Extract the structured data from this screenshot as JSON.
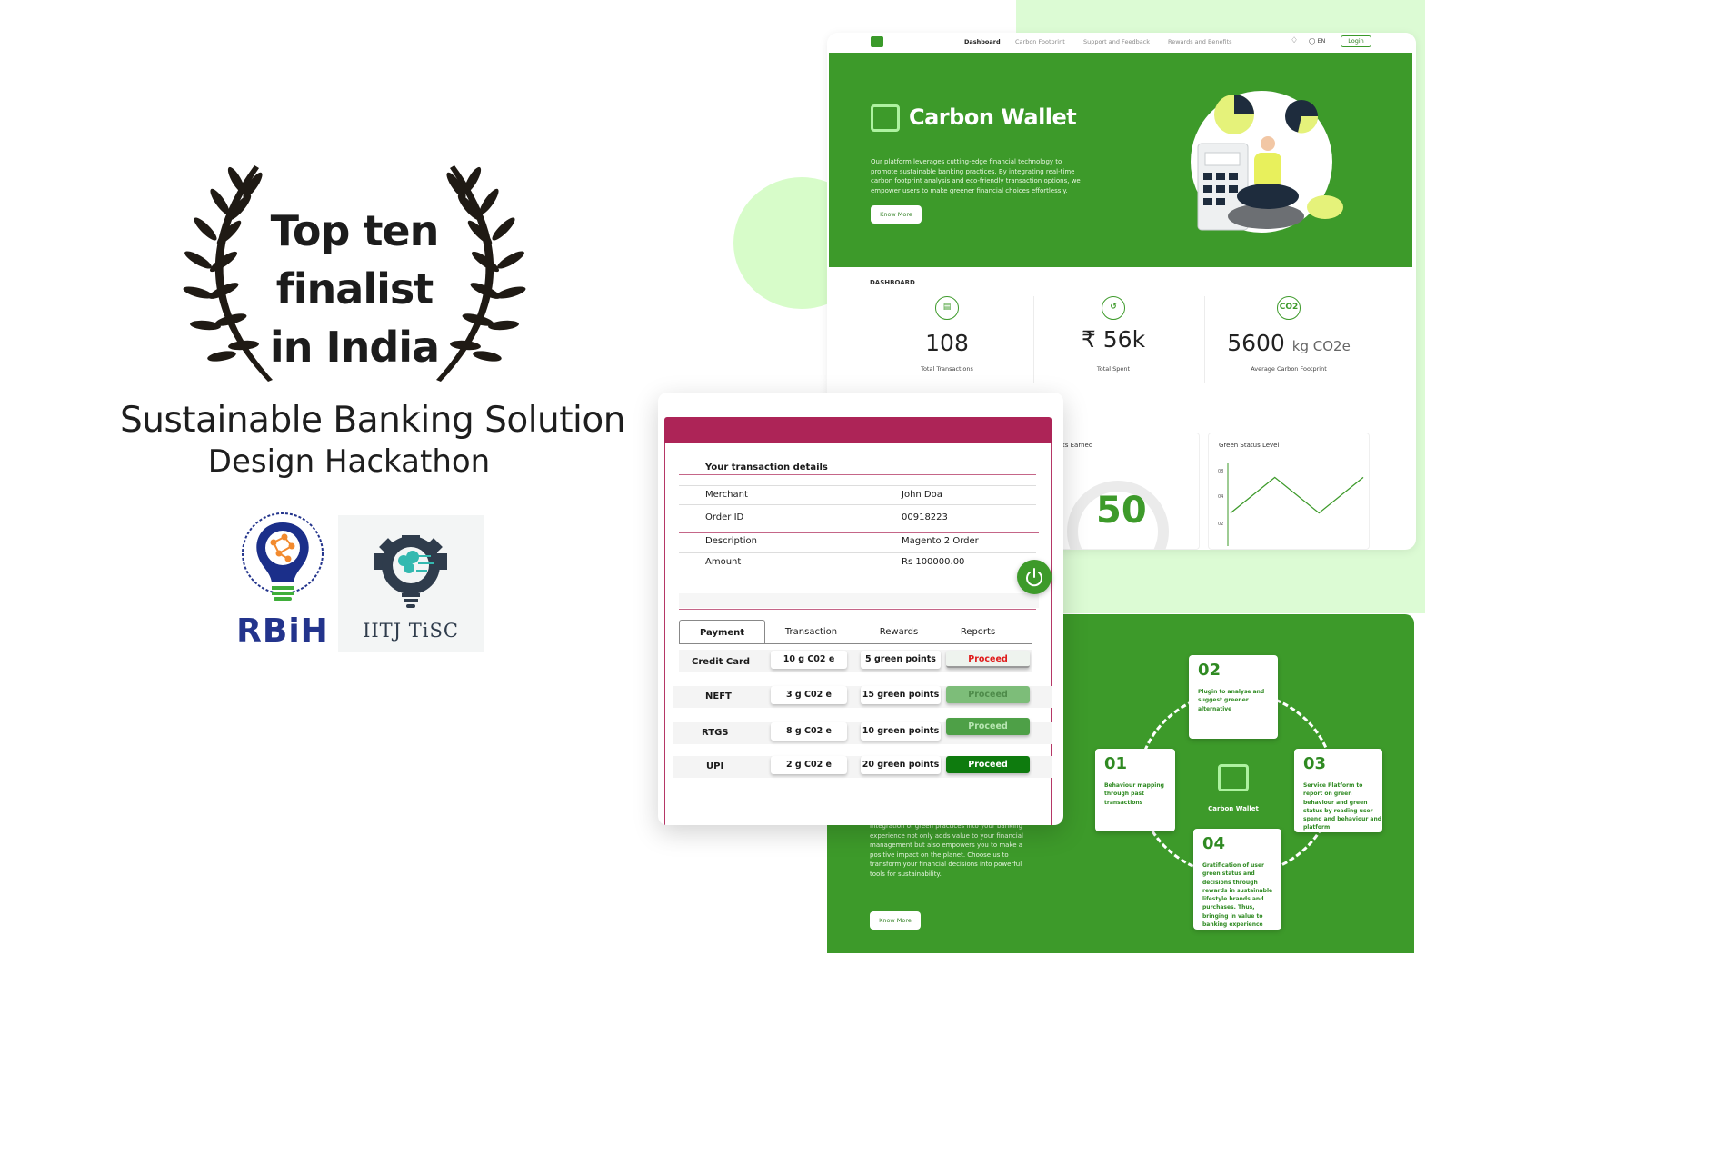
{
  "award": {
    "lines": [
      "Top ten",
      "finalist",
      "in India"
    ],
    "hackathon_title": "Sustainable Banking Solution",
    "hackathon_subtitle": "Design Hackathon"
  },
  "logos": {
    "rbih": "RBiH",
    "iitj": "IITJ TiSC"
  },
  "dashboard": {
    "nav": {
      "items": [
        "Dashboard",
        "Carbon Footprint",
        "Support and Feedback",
        "Rewards and Benefits"
      ],
      "lang": "EN",
      "login": "Login"
    },
    "hero": {
      "title": "Carbon Wallet",
      "description": "Our platform leverages cutting-edge financial technology to promote sustainable banking practices. By integrating real-time carbon footprint analysis and eco-friendly transaction options, we empower users to make greener financial choices effortlessly.",
      "button": "Know More"
    },
    "section_label": "DASHBOARD",
    "stats": [
      {
        "icon": "wallet-icon",
        "value": "108",
        "unit": "",
        "label": "Total Transactions"
      },
      {
        "icon": "rupee-exchange-icon",
        "value": "₹ 56k",
        "unit": "",
        "label": "Total Spent"
      },
      {
        "icon": "co2-icon",
        "icon_text": "CO2",
        "value": "5600",
        "unit": "kg CO2e",
        "label": "Average Carbon Footprint"
      }
    ],
    "panels": {
      "points_title": "ts Earned",
      "points_value": "50",
      "green_title": "Green Status Level",
      "green_ticks": [
        "08",
        "04",
        "02"
      ],
      "green_line": [
        0.15,
        0.85,
        0.15,
        0.85
      ]
    }
  },
  "transaction": {
    "section_title": "Your  transaction details",
    "details": [
      {
        "key": "Merchant",
        "value": "John Doa"
      },
      {
        "key": "Order ID",
        "value": "00918223"
      },
      {
        "key": "Description",
        "value": "Magento 2 Order"
      },
      {
        "key": "Amount",
        "value": "Rs 100000.00"
      }
    ],
    "tabs": [
      "Payment",
      "Transaction",
      "Rewards",
      "Reports"
    ],
    "active_tab": "Payment",
    "rows": [
      {
        "mode": "Credit Card",
        "co2": "10 g C02 e",
        "points": "5 green points",
        "action": "Proceed"
      },
      {
        "mode": "NEFT",
        "co2": "3 g C02 e",
        "points": "15 green points",
        "action": "Proceed"
      },
      {
        "mode": "RTGS",
        "co2": "8 g C02 e",
        "points": "10 green points",
        "action": "Proceed"
      },
      {
        "mode": "UPI",
        "co2": "2 g C02 e",
        "points": "20 green points",
        "action": "Proceed"
      }
    ]
  },
  "process": {
    "description": "Integration of green practices into your banking experience not only adds value to your financial management but also empowers you to make a positive impact on the planet. Choose us to transform your financial decisions into powerful tools for sustainability.",
    "button": "Know More",
    "center_label": "Carbon Wallet",
    "steps": [
      {
        "num": "01",
        "text": "Behaviour mapping through past transactions"
      },
      {
        "num": "02",
        "text": "Plugin to analyse and suggest greener alternative"
      },
      {
        "num": "03",
        "text": "Service Platform to report on green behaviour and green status  by reading user spend and behaviour and platform"
      },
      {
        "num": "04",
        "text": "Gratification of user green status and decisions through rewards in sustainable lifestyle brands and purchases.  Thus, bringing in value to banking experience"
      }
    ]
  },
  "colors": {
    "brand_green": "#3d9a2a",
    "accent_magenta": "#ad2457",
    "light_green_bg": "#dcfbd4",
    "proceed_red": "#e01b1b"
  }
}
